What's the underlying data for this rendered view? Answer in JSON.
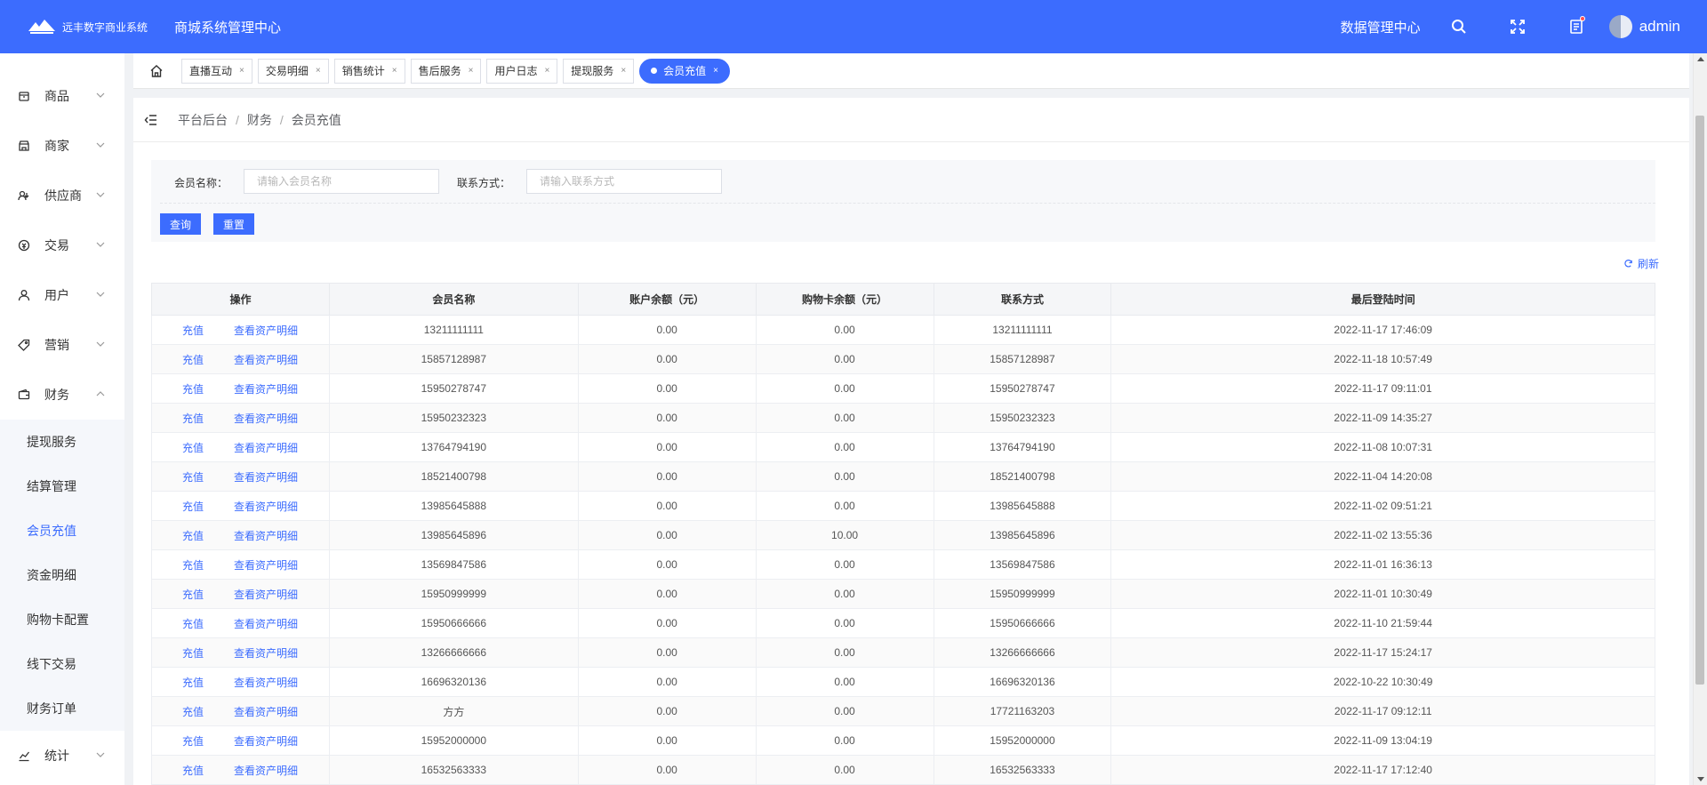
{
  "header": {
    "brand": "远丰数字商业系统",
    "title": "商城系统管理中心",
    "data_center": "数据管理中心",
    "user": "admin",
    "colors": {
      "primary": "#3c6cfe"
    }
  },
  "sidebar": {
    "items": [
      {
        "label": "商品",
        "icon": "box-icon"
      },
      {
        "label": "商家",
        "icon": "store-icon"
      },
      {
        "label": "供应商",
        "icon": "supplier-icon"
      },
      {
        "label": "交易",
        "icon": "trade-icon"
      },
      {
        "label": "用户",
        "icon": "user-icon"
      },
      {
        "label": "营销",
        "icon": "tag-icon"
      },
      {
        "label": "财务",
        "icon": "wallet-icon"
      }
    ],
    "finance_sub": [
      {
        "label": "提现服务"
      },
      {
        "label": "结算管理"
      },
      {
        "label": "会员充值",
        "active": true
      },
      {
        "label": "资金明细"
      },
      {
        "label": "购物卡配置"
      },
      {
        "label": "线下交易"
      },
      {
        "label": "财务订单"
      }
    ],
    "stats": {
      "label": "统计",
      "icon": "chart-icon"
    }
  },
  "tabs": [
    {
      "label": "直播互动"
    },
    {
      "label": "交易明细"
    },
    {
      "label": "销售统计"
    },
    {
      "label": "售后服务"
    },
    {
      "label": "用户日志"
    },
    {
      "label": "提现服务"
    },
    {
      "label": "会员充值",
      "active": true
    }
  ],
  "tab_close": "×",
  "breadcrumb": [
    "平台后台",
    "财务",
    "会员充值"
  ],
  "breadcrumb_sep": "/",
  "filter": {
    "name_label": "会员名称：",
    "name_placeholder": "请输入会员名称",
    "contact_label": "联系方式：",
    "contact_placeholder": "请输入联系方式",
    "query": "查询",
    "reset": "重置"
  },
  "refresh": "刷新",
  "table": {
    "columns": [
      "操作",
      "会员名称",
      "账户余额（元）",
      "购物卡余额（元）",
      "联系方式",
      "最后登陆时间"
    ],
    "action_recharge": "充值",
    "action_detail": "查看资产明细",
    "rows": [
      {
        "name": "13211111111",
        "balance": "0.00",
        "card": "0.00",
        "contact": "13211111111",
        "last_login": "2022-11-17 17:46:09"
      },
      {
        "name": "15857128987",
        "balance": "0.00",
        "card": "0.00",
        "contact": "15857128987",
        "last_login": "2022-11-18 10:57:49"
      },
      {
        "name": "15950278747",
        "balance": "0.00",
        "card": "0.00",
        "contact": "15950278747",
        "last_login": "2022-11-17 09:11:01"
      },
      {
        "name": "15950232323",
        "balance": "0.00",
        "card": "0.00",
        "contact": "15950232323",
        "last_login": "2022-11-09 14:35:27"
      },
      {
        "name": "13764794190",
        "balance": "0.00",
        "card": "0.00",
        "contact": "13764794190",
        "last_login": "2022-11-08 10:07:31"
      },
      {
        "name": "18521400798",
        "balance": "0.00",
        "card": "0.00",
        "contact": "18521400798",
        "last_login": "2022-11-04 14:20:08"
      },
      {
        "name": "13985645888",
        "balance": "0.00",
        "card": "0.00",
        "contact": "13985645888",
        "last_login": "2022-11-02 09:51:21"
      },
      {
        "name": "13985645896",
        "balance": "0.00",
        "card": "10.00",
        "contact": "13985645896",
        "last_login": "2022-11-02 13:55:36"
      },
      {
        "name": "13569847586",
        "balance": "0.00",
        "card": "0.00",
        "contact": "13569847586",
        "last_login": "2022-11-01 16:36:13"
      },
      {
        "name": "15950999999",
        "balance": "0.00",
        "card": "0.00",
        "contact": "15950999999",
        "last_login": "2022-11-01 10:30:49"
      },
      {
        "name": "15950666666",
        "balance": "0.00",
        "card": "0.00",
        "contact": "15950666666",
        "last_login": "2022-11-10 21:59:44"
      },
      {
        "name": "13266666666",
        "balance": "0.00",
        "card": "0.00",
        "contact": "13266666666",
        "last_login": "2022-11-17 15:24:17"
      },
      {
        "name": "16696320136",
        "balance": "0.00",
        "card": "0.00",
        "contact": "16696320136",
        "last_login": "2022-10-22 10:30:49"
      },
      {
        "name": "方方",
        "balance": "0.00",
        "card": "0.00",
        "contact": "17721163203",
        "last_login": "2022-11-17 09:12:11"
      },
      {
        "name": "15952000000",
        "balance": "0.00",
        "card": "0.00",
        "contact": "15952000000",
        "last_login": "2022-11-09 13:04:19"
      },
      {
        "name": "16532563333",
        "balance": "0.00",
        "card": "0.00",
        "contact": "16532563333",
        "last_login": "2022-11-17 17:12:40"
      }
    ]
  }
}
